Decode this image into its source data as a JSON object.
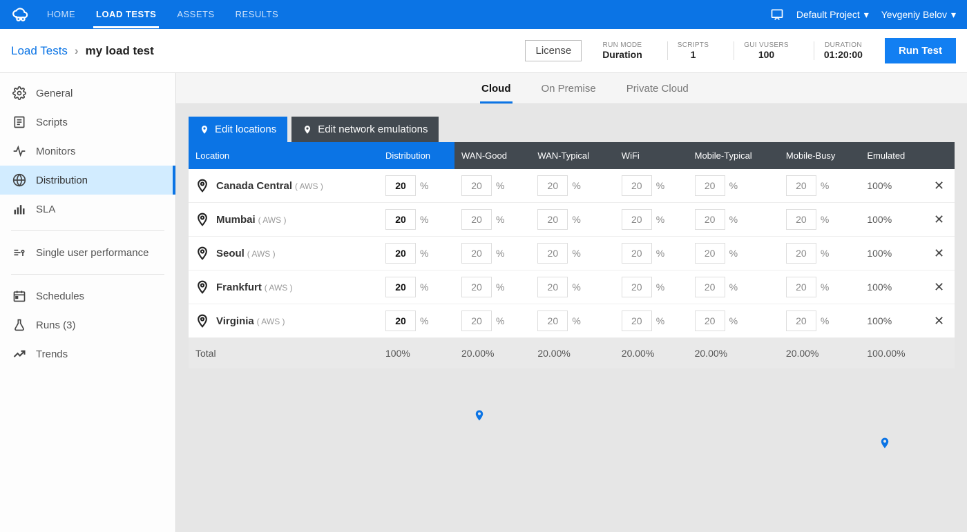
{
  "topnav": {
    "items": [
      "HOME",
      "LOAD TESTS",
      "ASSETS",
      "RESULTS"
    ],
    "active": 1,
    "project": "Default Project",
    "user": "Yevgeniy Belov"
  },
  "breadcrumb": {
    "parent": "Load Tests",
    "current": "my load test"
  },
  "license_btn": "License",
  "metrics": [
    {
      "lbl": "RUN MODE",
      "val": "Duration"
    },
    {
      "lbl": "SCRIPTS",
      "val": "1"
    },
    {
      "lbl": "GUI VUSERS",
      "val": "100"
    },
    {
      "lbl": "DURATION",
      "val": "01:20:00"
    }
  ],
  "run_btn": "Run Test",
  "sidebar": [
    {
      "icon": "gear",
      "label": "General"
    },
    {
      "icon": "script",
      "label": "Scripts"
    },
    {
      "icon": "pulse",
      "label": "Monitors"
    },
    {
      "icon": "globe",
      "label": "Distribution",
      "active": true
    },
    {
      "icon": "sla",
      "label": "SLA"
    },
    {
      "sep": true
    },
    {
      "icon": "user",
      "label": "Single user performance"
    },
    {
      "sep": true
    },
    {
      "icon": "calendar",
      "label": "Schedules"
    },
    {
      "icon": "flask",
      "label": "Runs (3)"
    },
    {
      "icon": "trend",
      "label": "Trends"
    }
  ],
  "tabs": {
    "items": [
      "Cloud",
      "On Premise",
      "Private Cloud"
    ],
    "active": 0
  },
  "toolbar": {
    "edit_locations": "Edit locations",
    "edit_emulations": "Edit network emulations"
  },
  "columns": [
    "Location",
    "Distribution",
    "WAN-Good",
    "WAN-Typical",
    "WiFi",
    "Mobile-Typical",
    "Mobile-Busy",
    "Emulated"
  ],
  "rows": [
    {
      "name": "Canada Central",
      "prov": "( AWS )",
      "dist": "20",
      "wan_good": "20",
      "wan_typ": "20",
      "wifi": "20",
      "mob_typ": "20",
      "mob_busy": "20",
      "emu": "100%"
    },
    {
      "name": "Mumbai",
      "prov": "( AWS )",
      "dist": "20",
      "wan_good": "20",
      "wan_typ": "20",
      "wifi": "20",
      "mob_typ": "20",
      "mob_busy": "20",
      "emu": "100%"
    },
    {
      "name": "Seoul",
      "prov": "( AWS )",
      "dist": "20",
      "wan_good": "20",
      "wan_typ": "20",
      "wifi": "20",
      "mob_typ": "20",
      "mob_busy": "20",
      "emu": "100%"
    },
    {
      "name": "Frankfurt",
      "prov": "( AWS )",
      "dist": "20",
      "wan_good": "20",
      "wan_typ": "20",
      "wifi": "20",
      "mob_typ": "20",
      "mob_busy": "20",
      "emu": "100%"
    },
    {
      "name": "Virginia",
      "prov": "( AWS )",
      "dist": "20",
      "wan_good": "20",
      "wan_typ": "20",
      "wifi": "20",
      "mob_typ": "20",
      "mob_busy": "20",
      "emu": "100%"
    }
  ],
  "totals": {
    "label": "Total",
    "dist": "100%",
    "wan_good": "20.00%",
    "wan_typ": "20.00%",
    "wifi": "20.00%",
    "mob_typ": "20.00%",
    "mob_busy": "20.00%",
    "emu": "100.00%"
  }
}
